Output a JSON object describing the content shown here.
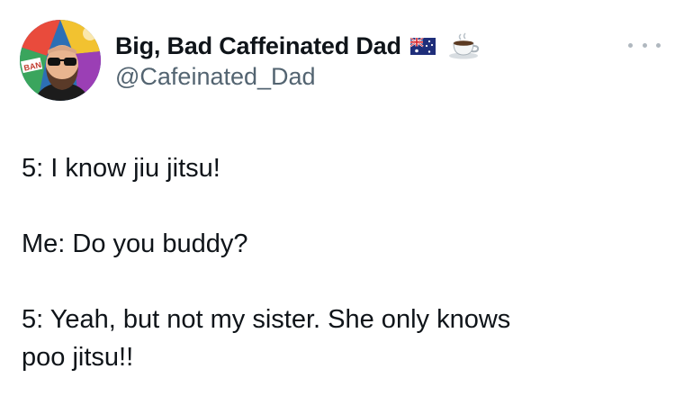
{
  "author": {
    "display_name": "Big, Bad Caffeinated Dad",
    "handle": "@Cafeinated_Dad",
    "name_emojis": [
      "australia-flag-icon",
      "coffee-cup-icon"
    ],
    "avatar_badge_text": "BAN"
  },
  "tweet": {
    "lines": [
      "5: I know jiu jitsu!",
      "Me: Do you buddy?",
      "5: Yeah, but not my sister. She only knows",
      "poo jitsu!!"
    ]
  },
  "colors": {
    "text": "#0f1419",
    "secondary_text": "#536471",
    "background": "#ffffff"
  }
}
